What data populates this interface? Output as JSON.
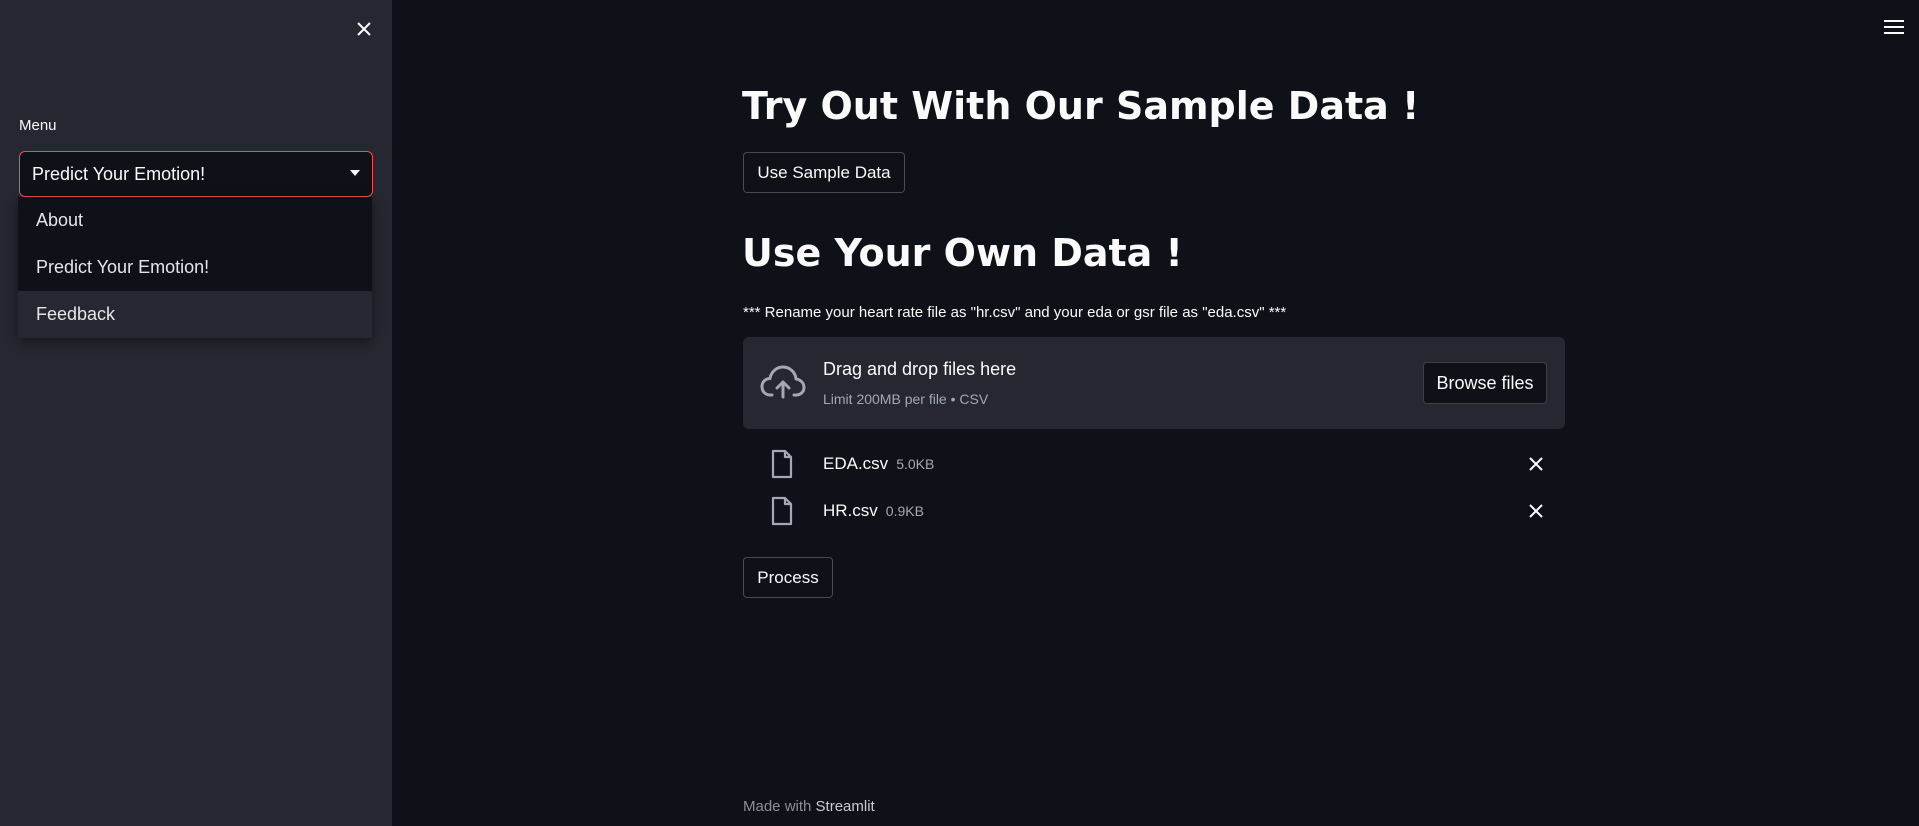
{
  "sidebar": {
    "close_icon": "close-icon",
    "menu_label": "Menu",
    "select": {
      "value": "Predict Your Emotion!",
      "accent_color": "#ff4b4b"
    },
    "options": [
      {
        "label": "About"
      },
      {
        "label": "Predict Your Emotion!"
      },
      {
        "label": "Feedback"
      }
    ]
  },
  "header": {
    "menu_icon": "hamburger-menu-icon"
  },
  "main": {
    "sample_heading": "Try Out With Our Sample Data !",
    "sample_button": "Use Sample Data",
    "own_heading": "Use Your Own Data !",
    "rename_note": "*** Rename your heart rate file as \"hr.csv\" and your eda or gsr file as \"eda.csv\" ***",
    "uploader": {
      "icon": "cloud-upload-icon",
      "title": "Drag and drop files here",
      "limit": "Limit 200MB per file • CSV",
      "browse_label": "Browse files"
    },
    "files": [
      {
        "name": "EDA.csv",
        "size": "5.0KB",
        "icon": "file-icon"
      },
      {
        "name": "HR.csv",
        "size": "0.9KB",
        "icon": "file-icon"
      }
    ],
    "process_button": "Process"
  },
  "footer": {
    "prefix": "Made with",
    "brand": "Streamlit"
  },
  "colors": {
    "background": "#0e1117",
    "sidebar": "#262730",
    "text": "#fafafa",
    "muted": "#a3a8b4"
  }
}
